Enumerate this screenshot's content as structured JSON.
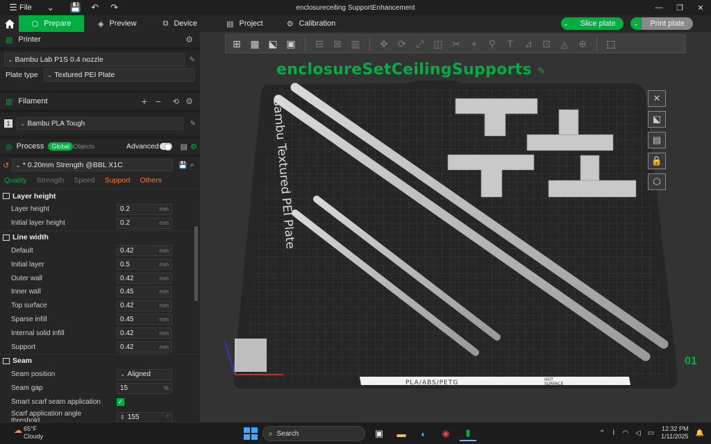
{
  "window": {
    "title": "enclosureceiling SupportEnhancement",
    "file_menu": "File"
  },
  "nav": {
    "tabs": [
      {
        "label": "Prepare",
        "icon": "cube-icon"
      },
      {
        "label": "Preview",
        "icon": "layers-icon"
      },
      {
        "label": "Device",
        "icon": "device-icon"
      },
      {
        "label": "Project",
        "icon": "project-icon"
      },
      {
        "label": "Calibration",
        "icon": "calibration-icon"
      }
    ],
    "slice_label": "Slice plate",
    "print_label": "Print plate"
  },
  "printer": {
    "section_label": "Printer",
    "name": "Bambu Lab P1S 0.4 nozzle",
    "plate_type_label": "Plate type",
    "plate_type": "Textured PEI Plate"
  },
  "filament": {
    "section_label": "Filament",
    "slot": "1",
    "name": "Bambu PLA Tough"
  },
  "process": {
    "section_label": "Process",
    "global_label": "Global",
    "objects_label": "Objects",
    "advanced_label": "Advanced",
    "preset": "* 0.20mm Strength @BBL X1C",
    "tabs": [
      "Quality",
      "Strength",
      "Speed",
      "Support",
      "Others"
    ]
  },
  "groups": {
    "layer_height": {
      "title": "Layer height",
      "rows": [
        {
          "label": "Layer height",
          "value": "0.2",
          "unit": "mm"
        },
        {
          "label": "Initial layer height",
          "value": "0.2",
          "unit": "mm"
        }
      ]
    },
    "line_width": {
      "title": "Line width",
      "rows": [
        {
          "label": "Default",
          "value": "0.42",
          "unit": "mm"
        },
        {
          "label": "Initial layer",
          "value": "0.5",
          "unit": "mm"
        },
        {
          "label": "Outer wall",
          "value": "0.42",
          "unit": "mm"
        },
        {
          "label": "Inner wall",
          "value": "0.45",
          "unit": "mm"
        },
        {
          "label": "Top surface",
          "value": "0.42",
          "unit": "mm"
        },
        {
          "label": "Sparse infill",
          "value": "0.45",
          "unit": "mm"
        },
        {
          "label": "Internal solid infill",
          "value": "0.42",
          "unit": "mm"
        },
        {
          "label": "Support",
          "value": "0.42",
          "unit": "mm"
        }
      ]
    },
    "seam": {
      "title": "Seam",
      "position_label": "Seam position",
      "position_value": "Aligned",
      "gap_label": "Seam gap",
      "gap_value": "15",
      "gap_unit": "%",
      "scarf_label": "Smart scarf seam application",
      "scarf_angle_label_1": "Scarf application angle",
      "scarf_angle_label_2": "threshold",
      "scarf_angle_value": "155",
      "scarf_angle_unit": "°"
    }
  },
  "viewport": {
    "plate_name": "enclosureSetCeilingSupports",
    "bed_label": "Bambu Textured PEI Plate",
    "bed_material": "PLA/ABS/PETG",
    "bed_hot": "HOT",
    "bed_surface": "SURFACE",
    "plate_number": "01"
  },
  "taskbar": {
    "temp": "65°F",
    "weather": "Cloudy",
    "search_placeholder": "Search",
    "time": "12:32 PM",
    "date": "1/11/2025"
  },
  "colors": {
    "accent": "#00ae42",
    "warning_tab": "#ff7a2f"
  }
}
